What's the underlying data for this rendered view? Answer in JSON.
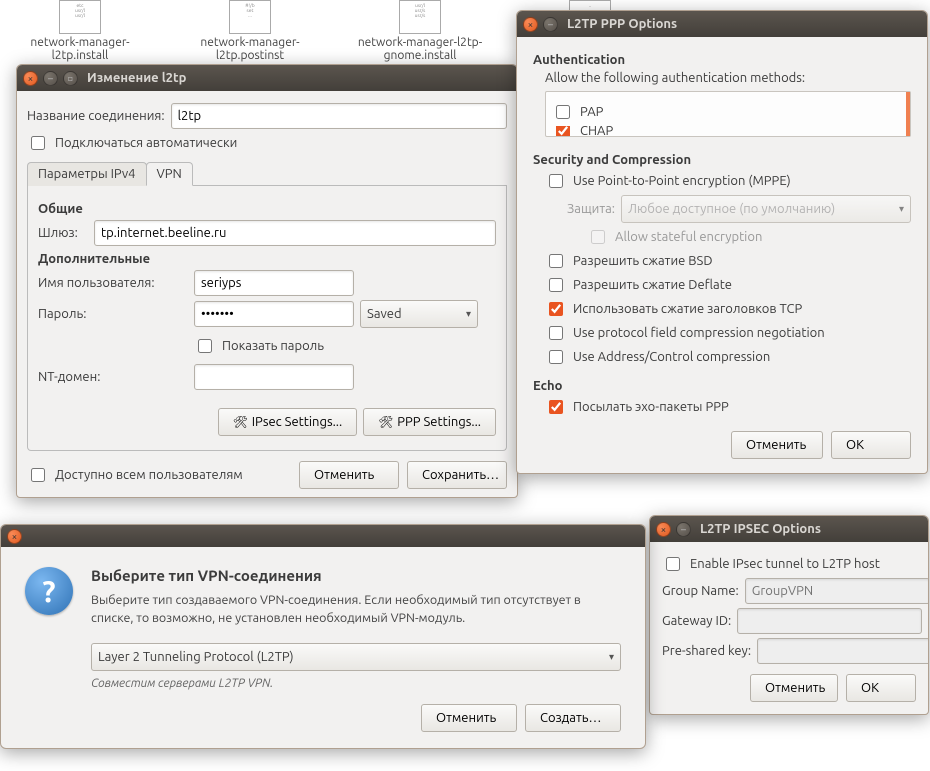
{
  "desktop": {
    "files": [
      "network-manager-l2tp.install",
      "network-manager-l2tp.postinst",
      "network-manager-l2tp-gnome.install",
      ""
    ]
  },
  "edit": {
    "title": "Изменение l2tp",
    "name_label": "Название соединения:",
    "name_value": "l2tp",
    "autoconnect": "Подключаться автоматически",
    "tab_ipv4": "Параметры IPv4",
    "tab_vpn": "VPN",
    "general_h": "Общие",
    "gateway_label": "Шлюз:",
    "gateway_value": "tp.internet.beeline.ru",
    "optional_h": "Дополнительные",
    "user_label": "Имя пользователя:",
    "user_value": "seriyps",
    "pass_label": "Пароль:",
    "pass_value": "•••••••",
    "pass_mode": "Saved",
    "showpass": "Показать пароль",
    "ntdomain_label": "NT-домен:",
    "ntdomain_value": "",
    "ipsec_btn": "IPsec Settings...",
    "ppp_btn": "PPP Settings...",
    "allusers": "Доступно всем пользователям",
    "cancel": "Отменить",
    "save": "Сохранить…"
  },
  "ppp": {
    "title": "L2TP PPP Options",
    "auth_h": "Authentication",
    "auth_desc": "Allow the following authentication methods:",
    "auth_pap": "PAP",
    "auth_chap": "CHAP",
    "sec_h": "Security and Compression",
    "mppe": "Use Point-to-Point encryption (MPPE)",
    "protect_label": "Защита:",
    "protect_value": "Любое доступное (по умолчанию)",
    "stateful": "Allow stateful encryption",
    "bsd": "Разрешить сжатие BSD",
    "deflate": "Разрешить сжатие Deflate",
    "tcphdr": "Использовать сжатие заголовков TCP",
    "pfc": "Use protocol field compression negotiation",
    "acc": "Use Address/Control compression",
    "echo_h": "Echo",
    "echo": "Посылать эхо-пакеты PPP",
    "cancel": "Отменить",
    "ok": "OK"
  },
  "ipsec": {
    "title": "L2TP IPSEC Options",
    "enable": "Enable IPsec tunnel to L2TP host",
    "group_label": "Group Name:",
    "group_ph": "GroupVPN",
    "gw_label": "Gateway ID:",
    "psk_label": "Pre-shared key:",
    "cancel": "Отменить",
    "ok": "OK"
  },
  "vpntype": {
    "heading": "Выберите тип VPN-соединения",
    "desc": "Выберите тип создаваемого VPN-соединения. Если необходимый тип отсутствует в списке, то возможно, не установлен необходимый VPN-модуль.",
    "selected": "Layer 2 Tunneling Protocol (L2TP)",
    "note": "Совместим серверами L2TP VPN.",
    "cancel": "Отменить",
    "create": "Создать…"
  }
}
